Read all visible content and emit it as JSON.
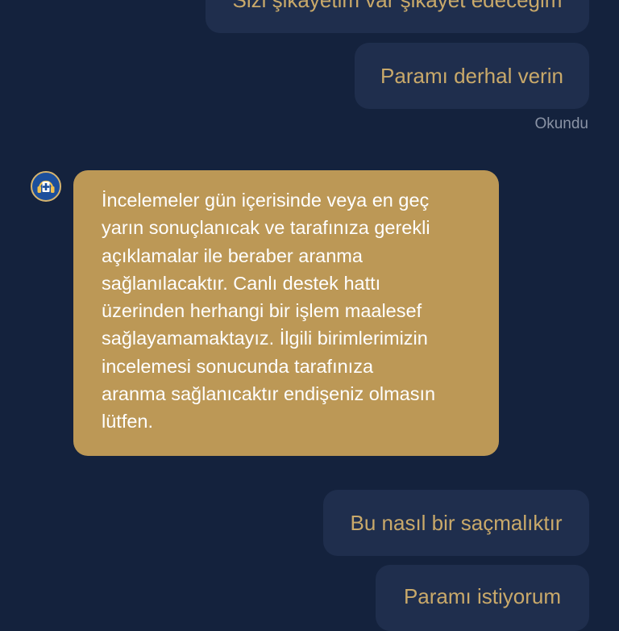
{
  "messages": {
    "sent_1": "Sizi şikayetim var şikayet edeceğim",
    "sent_2": "Paramı derhal verin",
    "read_status": "Okundu",
    "received_lines": [
      "İncelemeler gün içerisinde veya en geç",
      "yarın sonuçlanıcak ve tarafınıza gerekli",
      "açıklamalar ile beraber aranma",
      "sağlanılacaktır. Canlı destek hattı",
      "üzerinden herhangi bir işlem maalesef",
      "sağlayamamaktayız. İlgili birimlerimizin",
      "incelemesi sonucunda tarafınıza",
      "aranma sağlanıcaktır endişeniz olmasın",
      "lütfen."
    ],
    "sent_3": "Bu nasıl bir saçmalıktır",
    "sent_4": "Paramı istiyorum"
  },
  "colors": {
    "background": "#14223d",
    "sent_bubble": "#1f2e4d",
    "sent_text": "#c9a96a",
    "received_bubble": "#bc9856",
    "received_text": "#ffffff",
    "read_status": "#8a93a5"
  },
  "icons": {
    "agent_avatar": "support-agent-headset-icon"
  }
}
